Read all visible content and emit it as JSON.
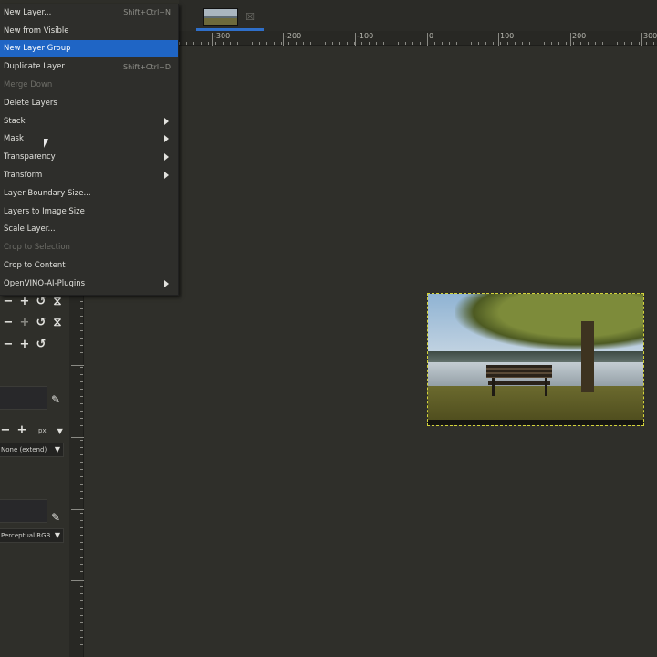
{
  "layer_menu": {
    "items": [
      {
        "label": "New Layer...",
        "shortcut": "Shift+Ctrl+N",
        "submenu": false,
        "disabled": false,
        "highlighted": false
      },
      {
        "label": "New from Visible",
        "shortcut": "",
        "submenu": false,
        "disabled": false,
        "highlighted": false
      },
      {
        "label": "New Layer Group",
        "shortcut": "",
        "submenu": false,
        "disabled": false,
        "highlighted": true
      },
      {
        "label": "Duplicate Layer",
        "shortcut": "Shift+Ctrl+D",
        "submenu": false,
        "disabled": false,
        "highlighted": false
      },
      {
        "label": "Merge Down",
        "shortcut": "",
        "submenu": false,
        "disabled": true,
        "highlighted": false
      },
      {
        "label": "Delete Layers",
        "shortcut": "",
        "submenu": false,
        "disabled": false,
        "highlighted": false
      },
      {
        "label": "Stack",
        "shortcut": "",
        "submenu": true,
        "disabled": false,
        "highlighted": false
      },
      {
        "label": "Mask",
        "shortcut": "",
        "submenu": true,
        "disabled": false,
        "highlighted": false
      },
      {
        "label": "Transparency",
        "shortcut": "",
        "submenu": true,
        "disabled": false,
        "highlighted": false
      },
      {
        "label": "Transform",
        "shortcut": "",
        "submenu": true,
        "disabled": false,
        "highlighted": false
      },
      {
        "label": "Layer Boundary Size...",
        "shortcut": "",
        "submenu": false,
        "disabled": false,
        "highlighted": false
      },
      {
        "label": "Layers to Image Size",
        "shortcut": "",
        "submenu": false,
        "disabled": false,
        "highlighted": false
      },
      {
        "label": "Scale Layer...",
        "shortcut": "",
        "submenu": false,
        "disabled": false,
        "highlighted": false
      },
      {
        "label": "Crop to Selection",
        "shortcut": "",
        "submenu": false,
        "disabled": true,
        "highlighted": false
      },
      {
        "label": "Crop to Content",
        "shortcut": "",
        "submenu": false,
        "disabled": false,
        "highlighted": false
      },
      {
        "label": "OpenVINO-AI-Plugins",
        "shortcut": "",
        "submenu": true,
        "disabled": false,
        "highlighted": false
      }
    ]
  },
  "ruler": {
    "h_labels": [
      "-300",
      "-200",
      "-100",
      "0",
      "100",
      "200",
      "300"
    ]
  },
  "tool_options": {
    "unit": "px",
    "interpolation": "None (extend)",
    "color_space": "Perceptual RGB"
  },
  "icons": {
    "remove": "−",
    "add": "+",
    "reset": "↺",
    "chain": "⧖",
    "edit": "✎",
    "dropdown": "▼",
    "image_close": "☒"
  }
}
